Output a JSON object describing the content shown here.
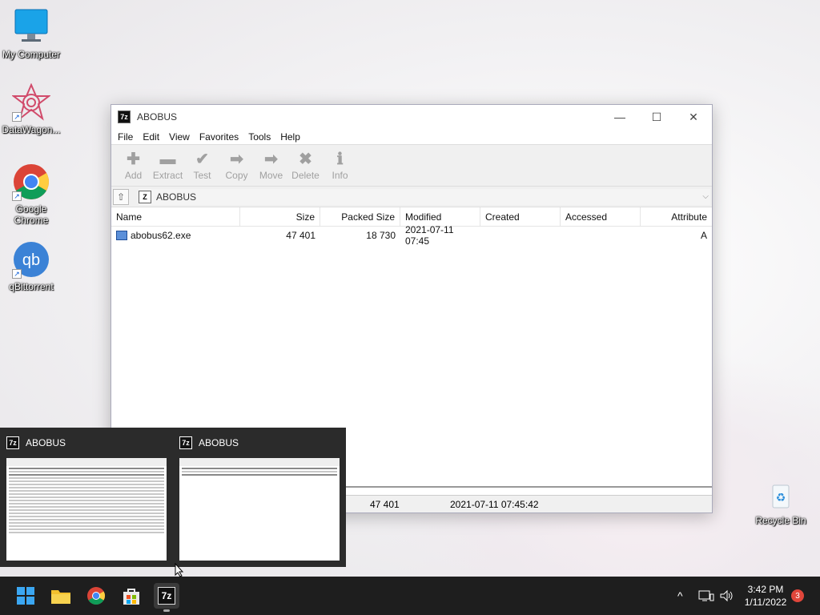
{
  "desktop": {
    "icons": [
      {
        "label": "My Computer",
        "icon": "monitor-icon"
      },
      {
        "label": "DataWagon...",
        "icon": "datawagon-icon"
      },
      {
        "label": "Google Chrome",
        "icon": "chrome-icon"
      },
      {
        "label": "qBittorrent",
        "icon": "qbittorrent-icon"
      },
      {
        "label": "Recycle Bin",
        "icon": "recycle-bin-icon"
      }
    ]
  },
  "window": {
    "title": "ABOBUS",
    "menu": [
      "File",
      "Edit",
      "View",
      "Favorites",
      "Tools",
      "Help"
    ],
    "toolbar": [
      "Add",
      "Extract",
      "Test",
      "Copy",
      "Move",
      "Delete",
      "Info"
    ],
    "address": "ABOBUS",
    "columns": [
      "Name",
      "Size",
      "Packed Size",
      "Modified",
      "Created",
      "Accessed",
      "Attribute"
    ],
    "rows": [
      {
        "name": "abobus62.exe",
        "size": "47 401",
        "packed": "18 730",
        "modified": "2021-07-11 07:45",
        "created": "",
        "accessed": "",
        "attr": "A"
      }
    ],
    "status": {
      "size": "47 401",
      "modified": "2021-07-11 07:45:42"
    }
  },
  "preview": {
    "items": [
      {
        "title": "ABOBUS"
      },
      {
        "title": "ABOBUS"
      }
    ]
  },
  "taskbar": {
    "time": "3:42 PM",
    "date": "1/11/2022",
    "notifications": "3",
    "tray_caret": "^"
  },
  "colors": {
    "taskbar": "#1e1e1e",
    "preview_bg": "#2b2b2b",
    "badge": "#e0463b"
  }
}
